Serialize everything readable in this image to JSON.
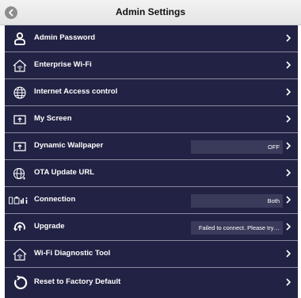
{
  "window": {
    "title": "Admin Settings"
  },
  "colors": {
    "list_background": "#222244",
    "divider": "#8d8aa0",
    "value_box": "#3a3a5a",
    "text": "#ffffff"
  },
  "menu": {
    "items": [
      {
        "label": "Admin Password",
        "icon": "person-icon"
      },
      {
        "label": "Enterprise Wi-Fi",
        "icon": "wifi-house-icon"
      },
      {
        "label": "Internet Access control",
        "icon": "globe-icon"
      },
      {
        "label": "My Screen",
        "icon": "screen-icon"
      },
      {
        "label": "Dynamic Wallpaper",
        "icon": "screen-icon",
        "value": "OFF"
      },
      {
        "label": "OTA Update URL",
        "icon": "globe-link-icon"
      },
      {
        "label": "Connection",
        "icon": "connection-icon",
        "value": "Both"
      },
      {
        "label": "Upgrade",
        "icon": "upgrade-icon",
        "value": "Failed to connect. Please try…"
      },
      {
        "label": "Wi-Fi Diagnostic Tool",
        "icon": "wifi-house-icon"
      },
      {
        "label": "Reset to Factory Default",
        "icon": "reset-icon"
      }
    ]
  }
}
